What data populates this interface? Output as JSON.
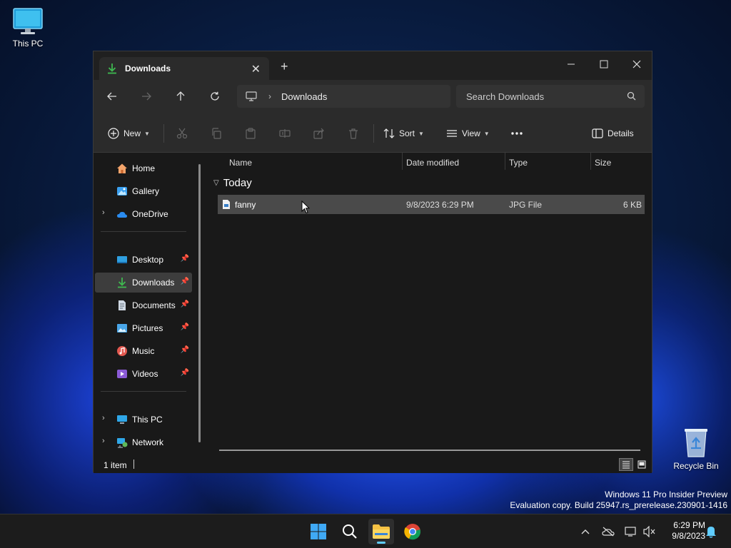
{
  "desktop": {
    "this_pc_label": "This PC",
    "recycle_bin_label": "Recycle Bin",
    "watermark_line1": "Windows 11 Pro Insider Preview",
    "watermark_line2": "Evaluation copy. Build 25947.rs_prerelease.230901-1416"
  },
  "window": {
    "tab_title": "Downloads",
    "address_path": "Downloads",
    "search_placeholder": "Search Downloads"
  },
  "commands": {
    "new_label": "New",
    "sort_label": "Sort",
    "view_label": "View",
    "details_label": "Details"
  },
  "nav": {
    "items": [
      {
        "label": "Home"
      },
      {
        "label": "Gallery"
      },
      {
        "label": "OneDrive"
      },
      {
        "label": "Desktop"
      },
      {
        "label": "Downloads"
      },
      {
        "label": "Documents"
      },
      {
        "label": "Pictures"
      },
      {
        "label": "Music"
      },
      {
        "label": "Videos"
      },
      {
        "label": "This PC"
      },
      {
        "label": "Network"
      }
    ]
  },
  "content": {
    "columns": [
      "Name",
      "Date modified",
      "Type",
      "Size"
    ],
    "group_label": "Today",
    "files": [
      {
        "name": "fanny",
        "date": "9/8/2023 6:29 PM",
        "type": "JPG File",
        "size": "6 KB"
      }
    ]
  },
  "status": {
    "item_count": "1 item"
  },
  "taskbar": {
    "time": "6:29 PM",
    "date": "9/8/2023"
  },
  "colors": {
    "accent": "#60cdff",
    "download_green": "#3fb950",
    "folder_yellow": "#f6c244"
  }
}
